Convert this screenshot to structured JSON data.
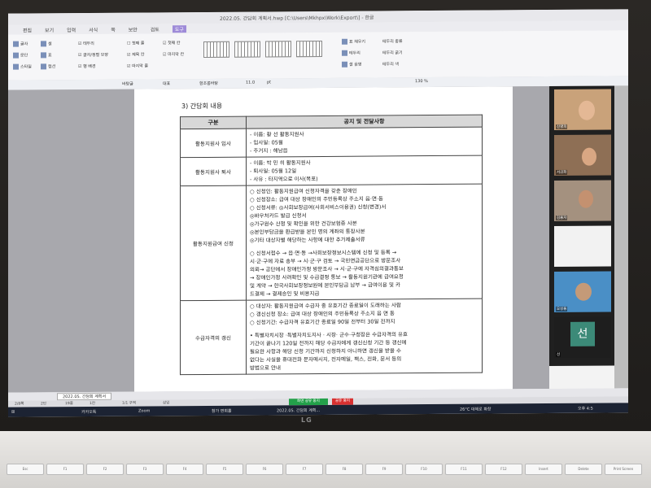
{
  "window": {
    "title": "2022.05. 간담회 계획서.hwp [C:\\Users\\Mkhpx\\Work\\Export\\] - 한글"
  },
  "menu": [
    "편집",
    "보기",
    "입력",
    "서식",
    "쪽",
    "보안",
    "검토",
    "도구"
  ],
  "ribbon": {
    "group1": [
      "글자",
      "문단",
      "스타일"
    ],
    "group2": [
      "셀",
      "표",
      "캡션"
    ],
    "checks_a": [
      "테두리",
      "글자/정렬 모양",
      "행 배경"
    ],
    "checks_b": [
      "첫째 줄",
      "제목 칸",
      "마지막 줄"
    ],
    "checks_c": [
      "첫째 칸",
      "마지막 칸"
    ],
    "right": [
      "표 채우기",
      "테두리",
      "셀 음영",
      "테두리 종류",
      "테두리 굵기",
      "테두리 색"
    ]
  },
  "formatbar": {
    "style": "바탕글",
    "lang": "대표",
    "font": "함초롬바탕",
    "size": "11.0",
    "unit": "pt",
    "zoom": "130 %"
  },
  "document": {
    "section_title": "3) 간담회 내용",
    "header_left": "구분",
    "header_right": "공지 및 전달사항",
    "rows": [
      {
        "label": "활동지원사 입사",
        "lines": [
          "- 이름: 황  선 활동지원사",
          "- 입사일: 05월",
          "- 주거지 : 해남읍"
        ]
      },
      {
        "label": "활동지원사 퇴사",
        "lines": [
          "- 이름: 박 민 히 활동지원사",
          "- 퇴사일: 05월 12일",
          "- 사유 : 타지역으로 이사(목포)"
        ]
      },
      {
        "label": "활동지원급여 신청",
        "lines": [
          "○ 신청인: 활동지원급여 신청자격을 갖춘 장애인",
          "○ 신청장소: 급여 대상 장애인의 주민등록상 주소지 읍·면·동",
          "○ 신청서류: ◎사회보장급여(사회서비스이용권) 신청(변경)서",
          "           ◎바우처카드 발급 신청서",
          "           ◎가구원수 산정 및 확인을 위한 건강보험증 사본",
          "           ◎본인부담금을 환급받을 본인 명의 계좌의 통장사본",
          "           ◎기타 대상자별 해당하는 사항에 대한 추가제출서류",
          "",
          "○ 신청서접수 → 읍·면·동 →사회보장정보시스템에 신청 및 등록 →",
          "시·군·구에 자료 송부 → 시·군·구 검토 → 국민연금공단으로 방문조사",
          "의뢰→ 공단에서 장애인가정 방문조사 → 시·군·구에 자격심의결과통보",
          "→ 장애인가정 사려확인 및 수급결정 통보 → 활동지원기관에 급여요청",
          "및 계약 → 한국사회보장정보원에 본인부담금 납부 → 급여이용 및 카",
          "드결제 → 결제승인 및 비용지급"
        ]
      },
      {
        "label": "수급자격의 갱신",
        "lines": [
          "○ 대상자: 활동지원급여 수급자 중 유효기간 종료일이 도래하는 사람",
          "○ 갱신신청 장소: 급여 대상 장애인의 주민등록상 주소지 읍 면 동",
          "○ 신청기간: 수급자격 유효기간 종료일 90일 전부터 30일 전까지",
          "",
          "• 특별자치시장 ·특별자치도지사 · 시장· 군수·구청장은 수급자격의 유효",
          "기간이 끝나기 120일 전까지 해당 수급자에게 갱신신청 기간 등 갱신에",
          "필요한 사항과 해당 신청 기간까지 신청하지 아니하면 갱신을 받을 수",
          "없다는 사실을 휴대전화 문자메시지, 전자메일, 팩스, 전화, 문서 등의",
          "방법으로 안내"
        ]
      }
    ]
  },
  "tabs": {
    "doc_tab": "2022.05. 간담회 계획서"
  },
  "statusbar": {
    "page": "2/8쪽",
    "section": "2단",
    "line": "19줄",
    "col": "1칸",
    "mode": "1/1 구역",
    "insert": "삽입",
    "record": "화면 공유 중지",
    "stop": "공유 중지"
  },
  "taskbar": {
    "apps": [
      "카카오톡",
      "Zoom",
      "참가 면회홀",
      "2022.05. 간담회 계획..."
    ],
    "weather": "26°C 대체로 화창",
    "time": "오후 4:5"
  },
  "zoom": {
    "participants": [
      "진영희",
      "서금화",
      "김용자",
      "",
      "오상용",
      "선"
    ],
    "avatar_letter": "선"
  },
  "laptop": {
    "brand": "LG"
  },
  "keyboard": {
    "keys": [
      "Esc",
      "F1",
      "F2",
      "F3",
      "F4",
      "F5",
      "F6",
      "F7",
      "F8",
      "F9",
      "F10",
      "F11",
      "F12",
      "Insert",
      "Delete",
      "Print Screen"
    ]
  }
}
